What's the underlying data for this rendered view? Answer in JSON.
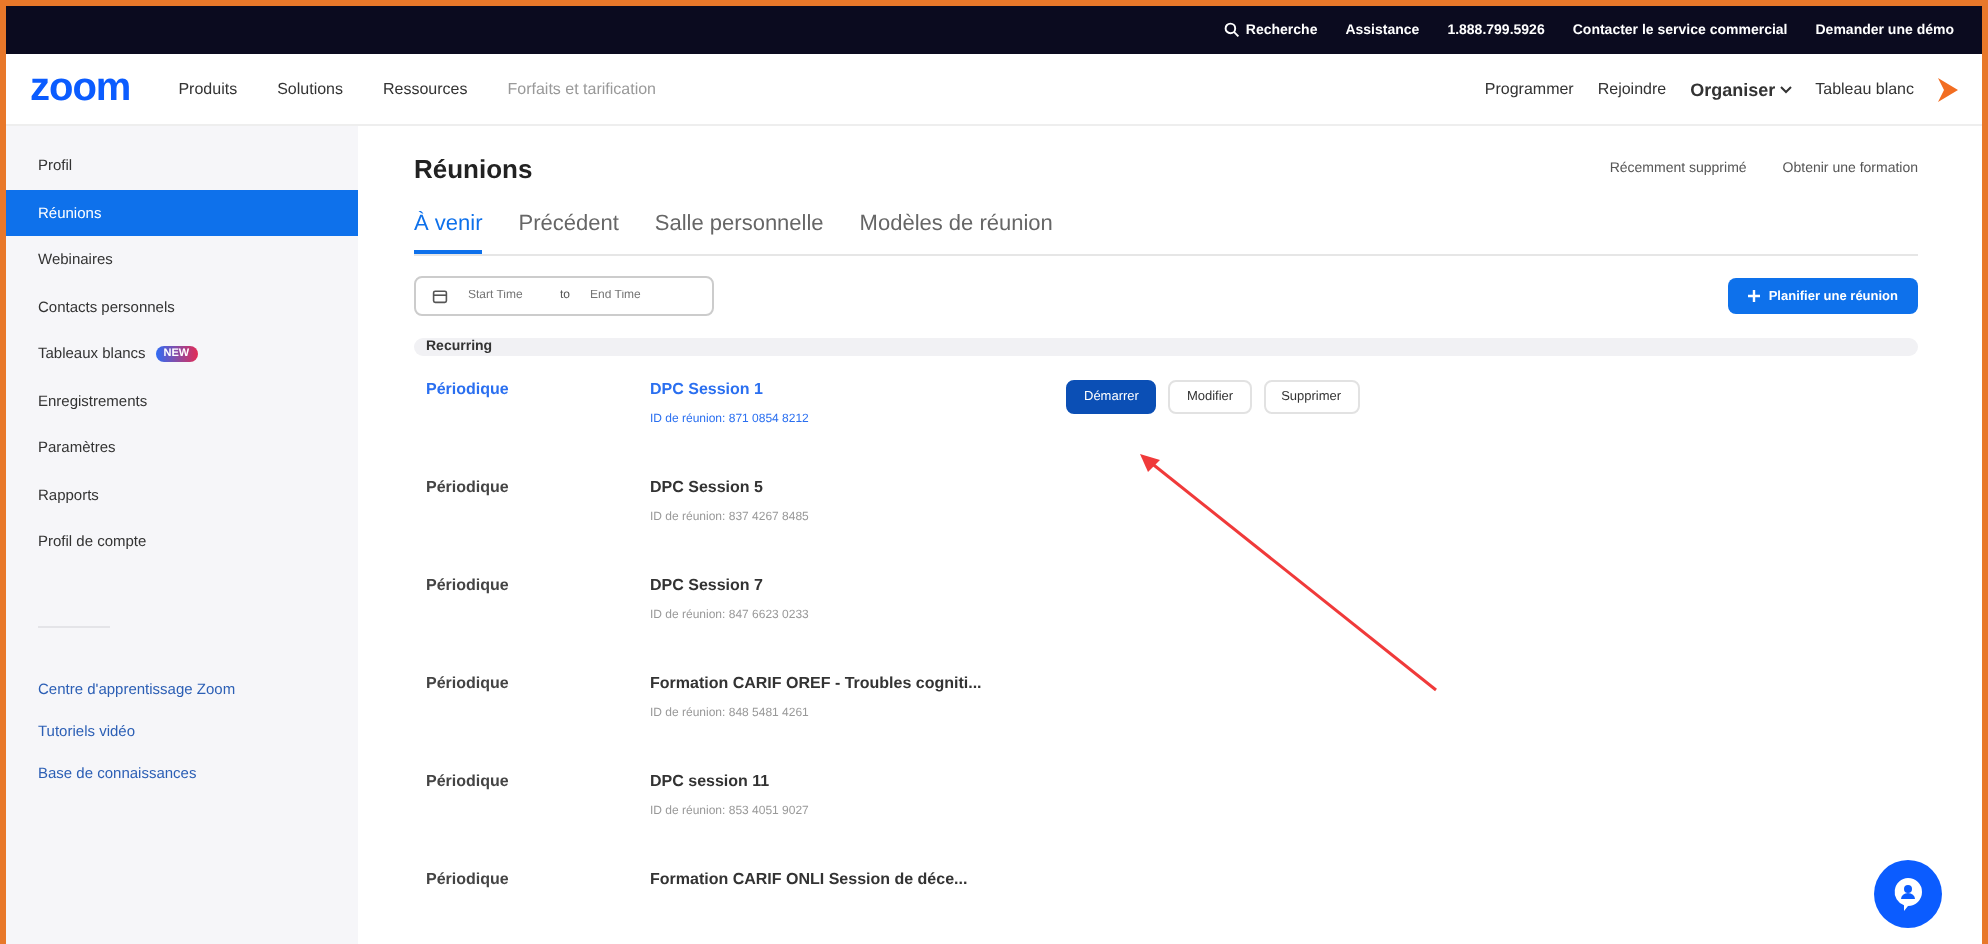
{
  "top_bar": {
    "links": [
      "Recherche",
      "Assistance",
      "1.888.799.5926",
      "Contacter le service commercial",
      "Demander une démo"
    ]
  },
  "nav": {
    "logo": "zoom",
    "items": [
      "Produits",
      "Solutions",
      "Ressources",
      "Forfaits et tarification"
    ],
    "right_items": [
      "Programmer",
      "Rejoindre",
      "Organiser",
      "Tableau blanc"
    ]
  },
  "sidebar": {
    "items": [
      {
        "label": "Profil",
        "selected": false
      },
      {
        "label": "Réunions",
        "selected": true
      },
      {
        "label": "Webinaires",
        "selected": false
      },
      {
        "label": "Contacts personnels",
        "selected": false
      },
      {
        "label": "Tableaux blancs",
        "selected": false,
        "badge": "NEW"
      },
      {
        "label": "Enregistrements",
        "selected": false
      },
      {
        "label": "Paramètres",
        "selected": false
      },
      {
        "label": "Rapports",
        "selected": false
      },
      {
        "label": "Profil de compte",
        "selected": false
      }
    ],
    "links": [
      "Centre d'apprentissage Zoom",
      "Tutoriels vidéo",
      "Base de connaissances"
    ]
  },
  "page": {
    "title": "Réunions",
    "header_links": [
      "Récemment supprimé",
      "Obtenir une formation"
    ],
    "tabs": [
      {
        "label": "À venir",
        "selected": true
      },
      {
        "label": "Précédent",
        "selected": false
      },
      {
        "label": "Salle personnelle",
        "selected": false
      },
      {
        "label": "Modèles de réunion",
        "selected": false
      }
    ],
    "date_range": {
      "start_placeholder": "Start Time",
      "separator": "to",
      "end_placeholder": "End Time"
    },
    "schedule_button": "Planifier une réunion",
    "section": "Recurring",
    "meetings": [
      {
        "type": "Périodique",
        "title": "DPC Session 1",
        "meeting_id": "ID de réunion: 871 0854 8212",
        "highlighted": true,
        "actions": [
          {
            "label": "Démarrer",
            "kind": "primary"
          },
          {
            "label": "Modifier",
            "kind": "secondary"
          },
          {
            "label": "Supprimer",
            "kind": "secondary"
          }
        ]
      },
      {
        "type": "Périodique",
        "title": "DPC Session 5",
        "meeting_id": "ID de réunion: 837 4267 8485",
        "highlighted": false
      },
      {
        "type": "Périodique",
        "title": "DPC Session 7",
        "meeting_id": "ID de réunion: 847 6623 0233",
        "highlighted": false
      },
      {
        "type": "Périodique",
        "title": "Formation CARIF OREF - Troubles cogniti...",
        "meeting_id": "ID de réunion: 848 5481 4261",
        "highlighted": false
      },
      {
        "type": "Périodique",
        "title": "DPC session 11",
        "meeting_id": "ID de réunion: 853 4051 9027",
        "highlighted": false
      },
      {
        "type": "Périodique",
        "title": "Formation CARIF ONLI Session de déce...",
        "highlighted": false
      }
    ]
  }
}
